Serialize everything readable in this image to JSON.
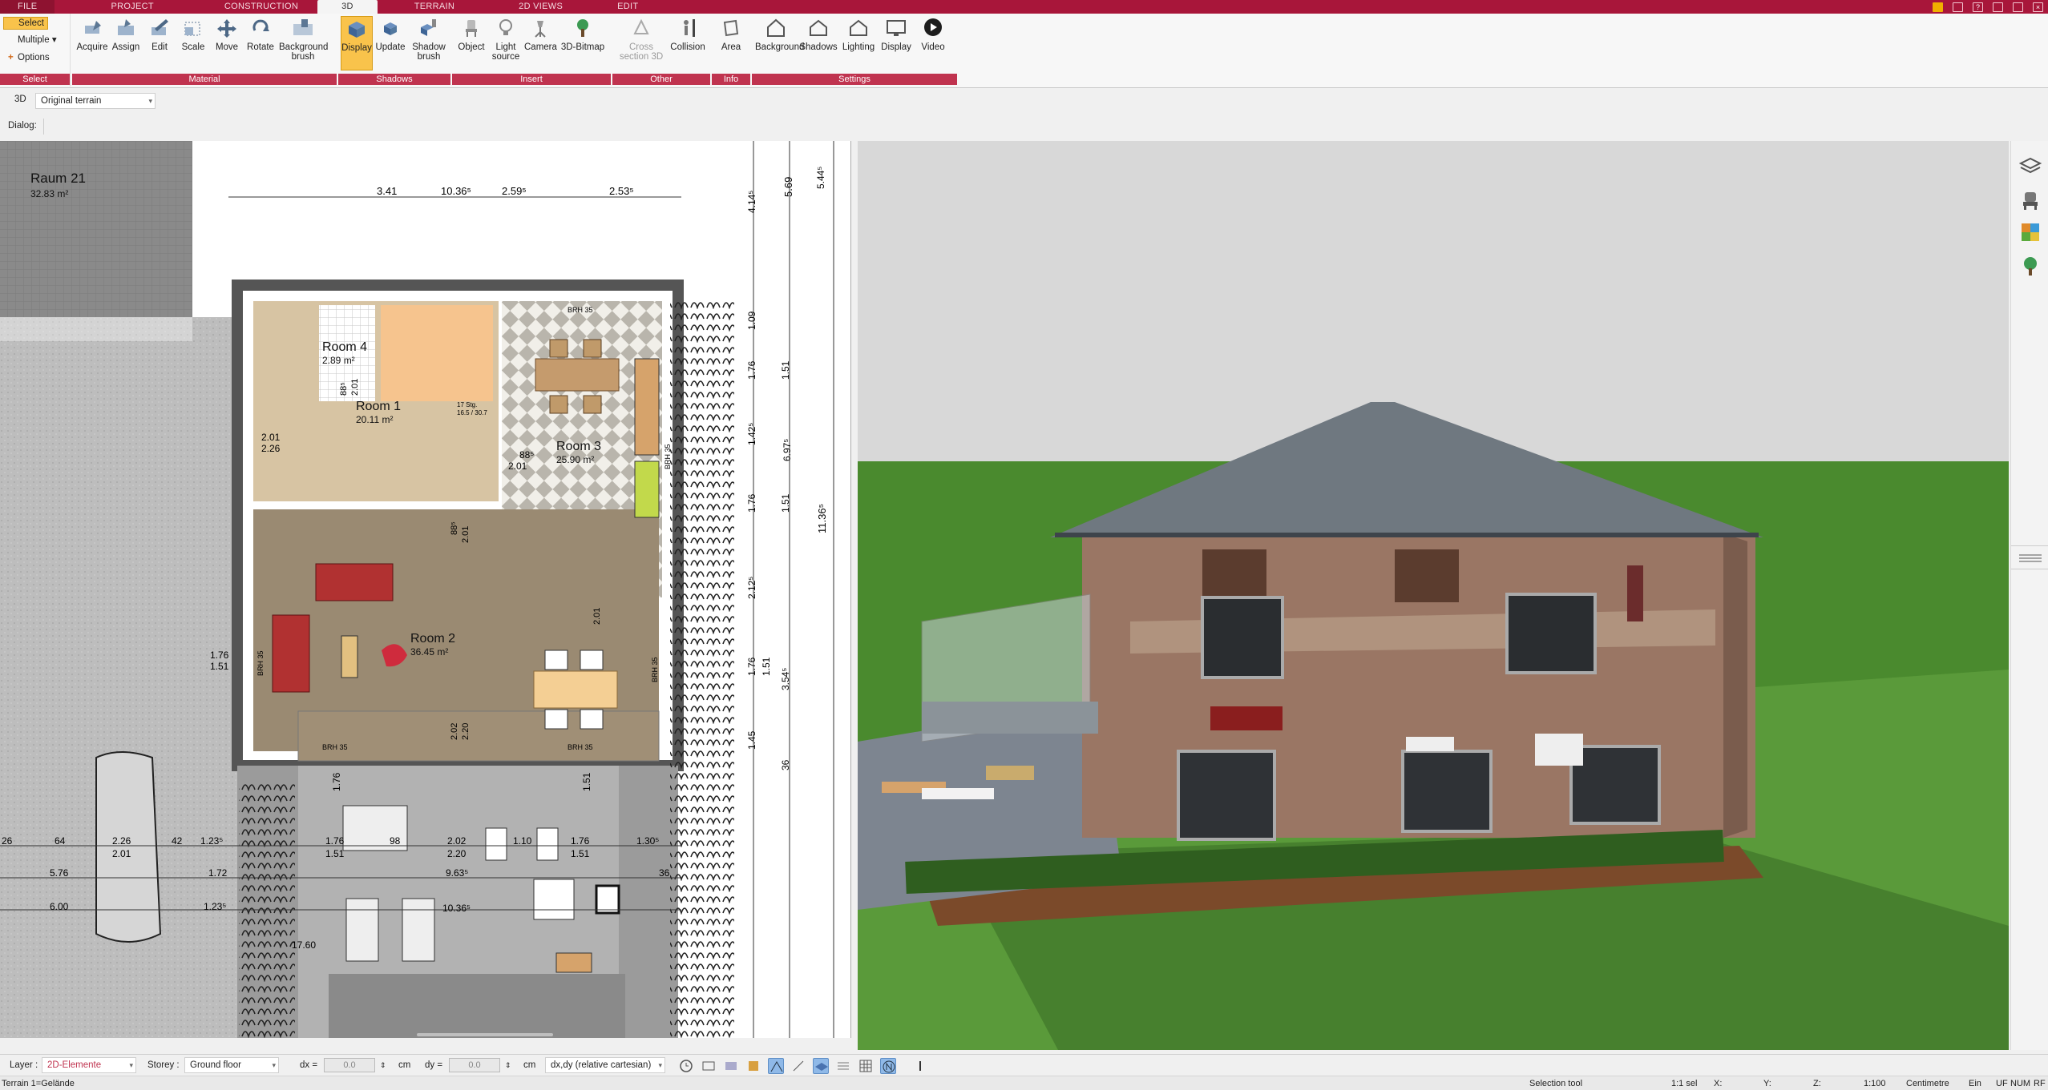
{
  "menu": {
    "tabs": [
      "FILE",
      "PROJECT",
      "CONSTRUCTION",
      "3D",
      "TERRAIN",
      "2D VIEWS",
      "EDIT"
    ],
    "active": "3D"
  },
  "ribbon": {
    "select": {
      "select_label": "Select",
      "multiple_label": "Multiple",
      "options_label": "Options",
      "group": "Select"
    },
    "material": {
      "group": "Material",
      "buttons": [
        "Acquire",
        "Assign",
        "Edit",
        "Scale",
        "Move",
        "Rotate",
        "Background brush"
      ]
    },
    "shadows": {
      "group": "Shadows",
      "buttons": [
        "Display",
        "Update",
        "Shadow brush"
      ]
    },
    "insert": {
      "group": "Insert",
      "buttons": [
        "Object",
        "Light source",
        "Camera",
        "3D-Bitmap"
      ]
    },
    "other": {
      "group": "Other",
      "buttons": [
        "Cross section 3D",
        "Collision"
      ]
    },
    "info": {
      "group": "Info",
      "buttons": [
        "Area"
      ]
    },
    "settings": {
      "group": "Settings",
      "buttons": [
        "Background",
        "Shadows",
        "Lighting",
        "Display",
        "Video"
      ]
    }
  },
  "toolbar2": {
    "mode": "3D",
    "terrain_select": "Original terrain"
  },
  "dialog_label": "Dialog:",
  "plan": {
    "rooms": [
      {
        "name": "Raum 21",
        "area": "32.83 m²"
      },
      {
        "name": "Room 4",
        "area": "2.89 m²"
      },
      {
        "name": "Room 1",
        "area": "20.11 m²"
      },
      {
        "name": "Room 3",
        "area": "25.90 m²"
      },
      {
        "name": "Room 2",
        "area": "36.45 m²"
      }
    ],
    "dims_top": [
      "3.41",
      "10.36⁵",
      "2.59⁵",
      "2.53⁵"
    ],
    "dims_right": [
      "5.69",
      "5.44⁵",
      "4.14⁵",
      "1.09",
      "1.76",
      "1.51",
      "1.42⁵",
      "6.97⁵",
      "1.76",
      "1.51",
      "11.36⁵",
      "2.12⁵",
      "1.76",
      "1.51",
      "3.54⁵",
      "1.45",
      "36"
    ],
    "dims_bottom": [
      "26",
      "64",
      "2.26",
      "2.01",
      "42",
      "1.23⁵",
      "1.76",
      "1.51",
      "98",
      "2.02",
      "2.20",
      "1.10",
      "1.76",
      "1.51",
      "1.30⁵",
      "5.76",
      "1.72",
      "9.63⁵",
      "36",
      "6.00",
      "1.23⁵",
      "10.36⁵",
      "17.60"
    ],
    "labels": [
      "BRH 35",
      "BRH 35",
      "BRH 35",
      "BRH 35",
      "BRH 35",
      "BRH 35",
      "2.01",
      "2.26",
      "88⁵",
      "2.01",
      "2.01",
      "88⁵",
      "2.01",
      "88⁵",
      "2.01",
      "1.76",
      "1.51",
      "1.76",
      "1.51",
      "17 Stg.",
      "16.5 / 30.7",
      "2.02",
      "2.20"
    ]
  },
  "statusbar": {
    "layer_label": "Layer :",
    "layer_value": "2D-Elemente",
    "storey_label": "Storey :",
    "storey_value": "Ground floor",
    "dx_label": "dx =",
    "dx_value": "0.0",
    "dx_unit": "cm",
    "dy_label": "dy =",
    "dy_value": "0.0",
    "dy_unit": "cm",
    "coord_mode": "dx,dy (relative cartesian)"
  },
  "bottombar": {
    "left": "Terrain 1=Gelände",
    "tool": "Selection tool",
    "scale_sel": "1:1 sel",
    "x": "X:",
    "y": "Y:",
    "z": "Z:",
    "scale": "1:100",
    "unit": "Centimetre",
    "ein": "Ein",
    "uf": "UF",
    "num": "NUM",
    "rf": "RF"
  },
  "colors": {
    "menubar": "#a8163a",
    "ribbon_group": "#c0334f",
    "active_btn": "#f9c34b",
    "sky": "#d8d8d8",
    "grass": "#4a8a2e"
  }
}
